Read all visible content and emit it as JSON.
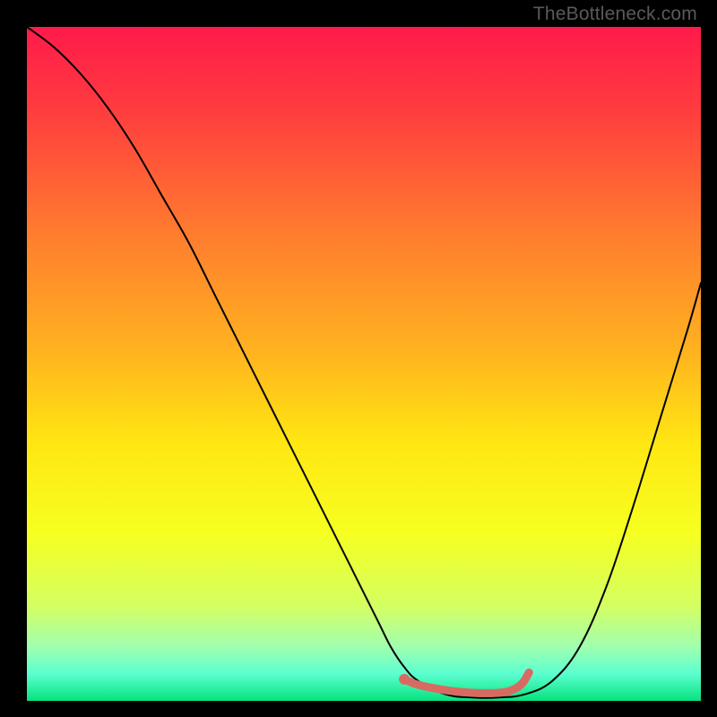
{
  "attribution": "TheBottleneck.com",
  "chart_data": {
    "type": "line",
    "title": "",
    "xlabel": "",
    "ylabel": "",
    "xlim": [
      0,
      100
    ],
    "ylim": [
      0,
      100
    ],
    "background_gradient": {
      "stops": [
        {
          "offset": 0.0,
          "color": "#ff1a4a"
        },
        {
          "offset": 0.12,
          "color": "#ff3b3f"
        },
        {
          "offset": 0.3,
          "color": "#ff7a2f"
        },
        {
          "offset": 0.48,
          "color": "#ffb21f"
        },
        {
          "offset": 0.62,
          "color": "#ffe712"
        },
        {
          "offset": 0.75,
          "color": "#f6ff20"
        },
        {
          "offset": 0.86,
          "color": "#d4ff63"
        },
        {
          "offset": 0.92,
          "color": "#a0ffb0"
        },
        {
          "offset": 0.96,
          "color": "#5bffd0"
        },
        {
          "offset": 1.0,
          "color": "#06e27e"
        }
      ]
    },
    "series": [
      {
        "name": "bottleneck-curve",
        "color": "#000000",
        "width": 2,
        "x": [
          0,
          4,
          8,
          12,
          16,
          20,
          24,
          28,
          32,
          36,
          40,
          44,
          48,
          52,
          54,
          56,
          58,
          62,
          66,
          70,
          74,
          78,
          82,
          86,
          90,
          94,
          98,
          100
        ],
        "values": [
          100,
          97,
          93,
          88,
          82,
          75,
          68,
          60,
          52,
          44,
          36,
          28,
          20,
          12,
          8,
          5,
          3,
          1,
          0.5,
          0.5,
          1,
          3,
          8,
          17,
          29,
          42,
          55,
          62
        ]
      },
      {
        "name": "optimal-marker",
        "type": "marker-line",
        "color": "#d86a62",
        "width": 9,
        "dot_radius": 6,
        "x": [
          56,
          58,
          62,
          66,
          70,
          72,
          73.5,
          74.5
        ],
        "values": [
          3.2,
          2.4,
          1.6,
          1.2,
          1.2,
          1.6,
          2.6,
          4.2
        ]
      }
    ]
  }
}
